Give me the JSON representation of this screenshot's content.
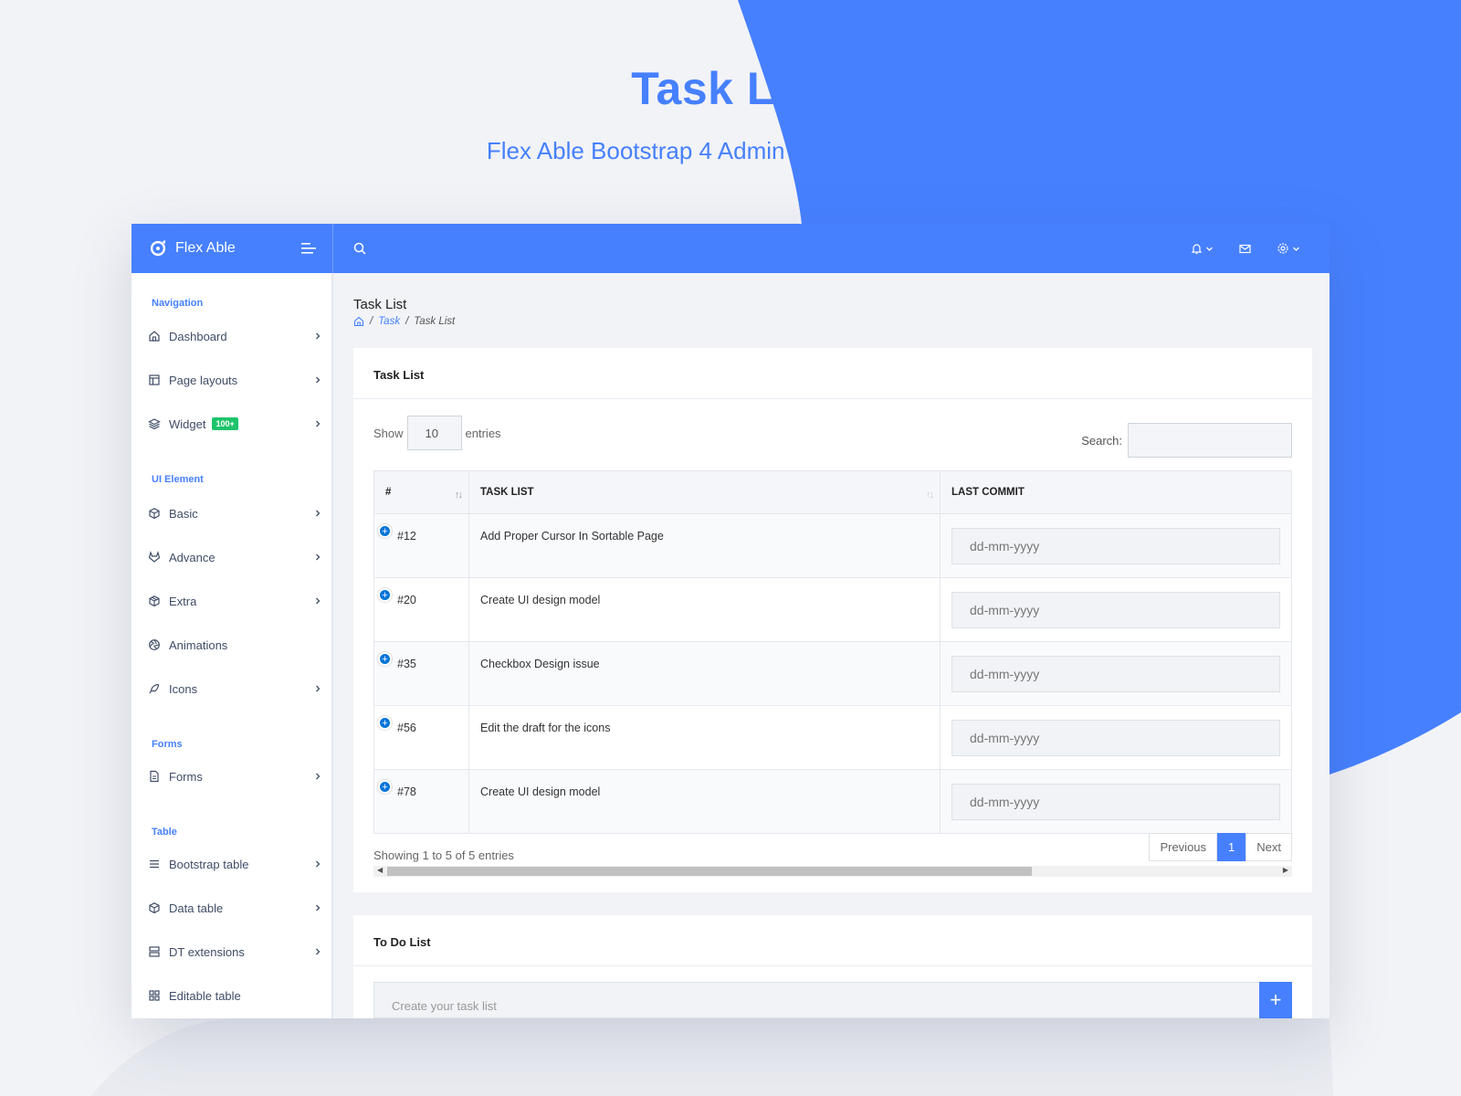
{
  "promo": {
    "title": "Task List",
    "subtitle": "Flex Able Bootstrap 4 Admin Template & UI Kit"
  },
  "colors": {
    "accent": "#4680ff",
    "badge": "#1dc36a"
  },
  "app": {
    "brand": "Flex Able"
  },
  "sidebar": {
    "captions": [
      "Navigation",
      "UI Element",
      "Forms",
      "Table"
    ],
    "items": [
      {
        "label": "Dashboard",
        "icon": "home-icon"
      },
      {
        "label": "Page layouts",
        "icon": "layout-icon"
      },
      {
        "label": "Widget",
        "icon": "layers-icon",
        "badge": "100+"
      },
      {
        "label": "Basic",
        "icon": "box-icon"
      },
      {
        "label": "Advance",
        "icon": "gitlab-icon"
      },
      {
        "label": "Extra",
        "icon": "package-icon"
      },
      {
        "label": "Animations",
        "icon": "aperture-icon"
      },
      {
        "label": "Icons",
        "icon": "feather-icon"
      },
      {
        "label": "Forms",
        "icon": "file-text-icon"
      },
      {
        "label": "Bootstrap table",
        "icon": "menu-icon"
      },
      {
        "label": "Data table",
        "icon": "box-icon"
      },
      {
        "label": "DT extensions",
        "icon": "server-icon"
      },
      {
        "label": "Editable table",
        "icon": "grid-icon"
      }
    ]
  },
  "page": {
    "title": "Task List",
    "breadcrumb": [
      "Task",
      "Task List"
    ]
  },
  "task_card": {
    "title": "Task List",
    "show_label": "Show",
    "show_value": "10",
    "entries_label": "entries",
    "search_label": "Search:",
    "columns": [
      "#",
      "TASK LIST",
      "LAST COMMIT"
    ],
    "rows": [
      {
        "id": "#12",
        "task": "Add Proper Cursor In Sortable Page",
        "commit": "dd-mm-yyyy"
      },
      {
        "id": "#20",
        "task": "Create UI design model",
        "commit": "dd-mm-yyyy"
      },
      {
        "id": "#35",
        "task": "Checkbox Design issue",
        "commit": "dd-mm-yyyy"
      },
      {
        "id": "#56",
        "task": "Edit the draft for the icons",
        "commit": "dd-mm-yyyy"
      },
      {
        "id": "#78",
        "task": "Create UI design model",
        "commit": "dd-mm-yyyy"
      }
    ],
    "info": "Showing 1 to 5 of 5 entries",
    "pager": {
      "prev": "Previous",
      "page": "1",
      "next": "Next"
    }
  },
  "todo_card": {
    "title": "To Do List",
    "placeholder": "Create your task list",
    "add": "+"
  }
}
